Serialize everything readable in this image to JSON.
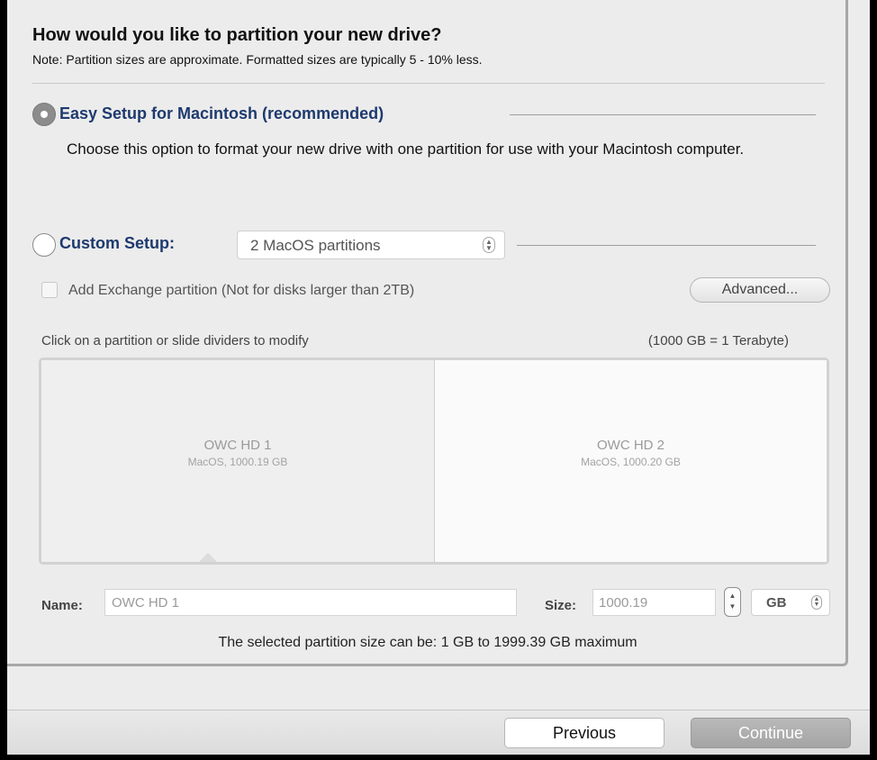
{
  "header": {
    "title": "How would you like to partition your new drive?",
    "note": "Note: Partition sizes are approximate.  Formatted sizes are typically 5 - 10% less."
  },
  "easy_setup": {
    "label": "Easy Setup for Macintosh (recommended)",
    "description": "Choose this option to format your new drive with one partition for use with your Macintosh computer.",
    "selected": true
  },
  "custom_setup": {
    "label": "Custom Setup:",
    "selected": false,
    "scheme": "2 MacOS partitions",
    "exchange_label": "Add Exchange partition  (Not for disks larger than 2TB)",
    "exchange_checked": false,
    "advanced_label": "Advanced..."
  },
  "partition_map": {
    "hint": "Click on a partition or slide dividers to modify",
    "unit_note": "(1000 GB = 1 Terabyte)",
    "partitions": [
      {
        "name": "OWC HD 1",
        "detail": "MacOS, 1000.19 GB"
      },
      {
        "name": "OWC HD 2",
        "detail": "MacOS, 1000.20 GB"
      }
    ]
  },
  "editor": {
    "name_label": "Name:",
    "name_value": "OWC HD 1",
    "size_label": "Size:",
    "size_value": "1000.19",
    "unit": "GB",
    "range_note": "The selected partition size can be: 1 GB to 1999.39 GB maximum"
  },
  "footer": {
    "previous_label": "Previous",
    "continue_label": "Continue"
  },
  "colors": {
    "accent_label": "#1e3a6e",
    "disabled_button": "#a4a4a4"
  }
}
